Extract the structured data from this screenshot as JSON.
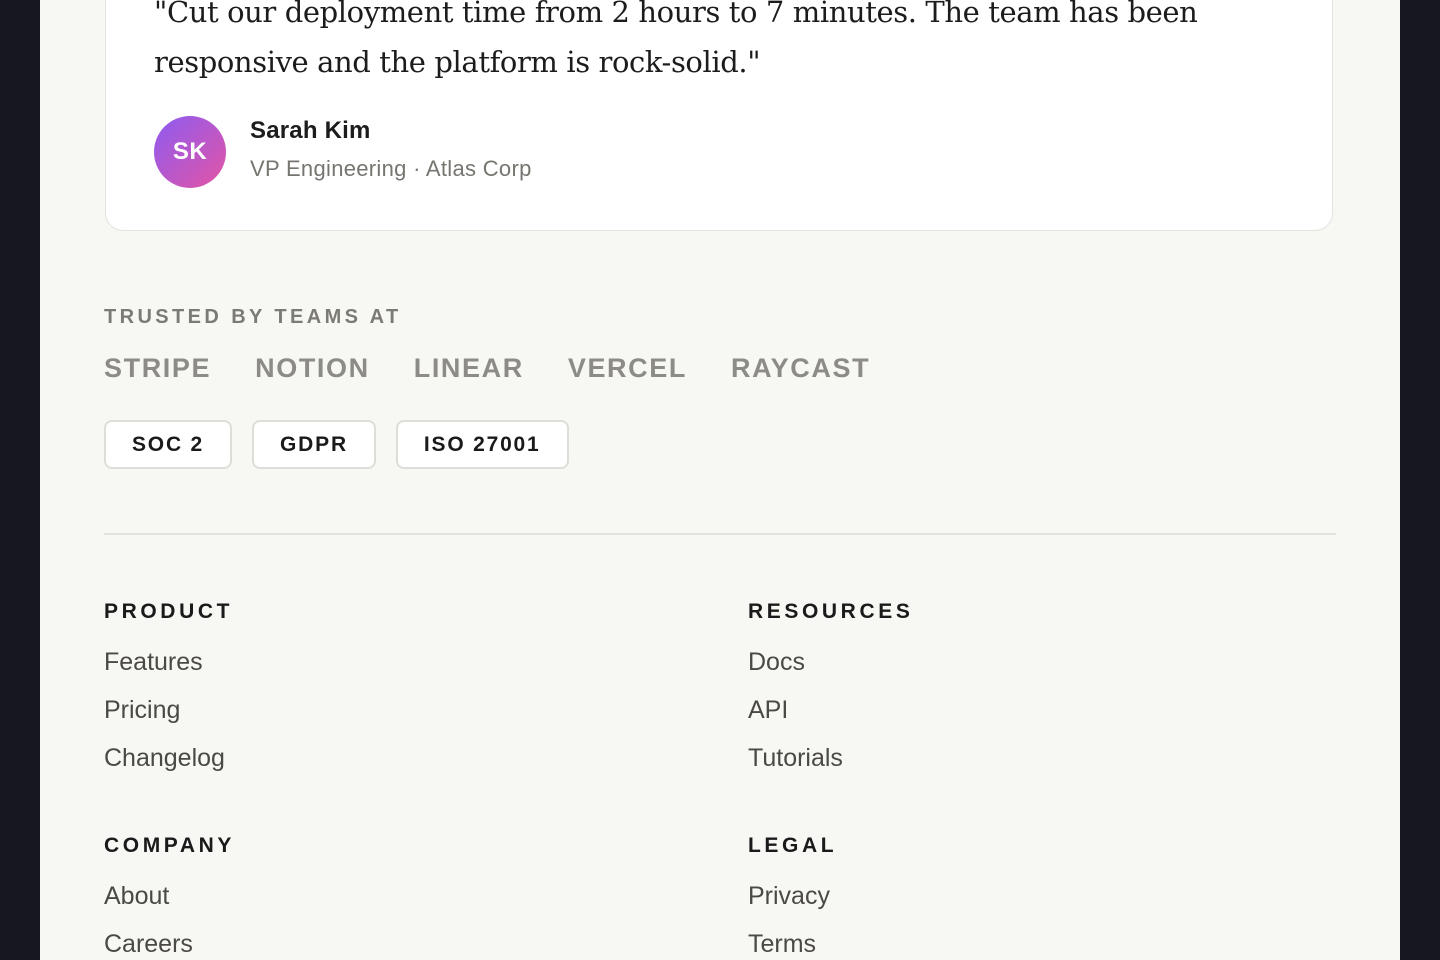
{
  "testimonial": {
    "quote": "\"Cut our deployment time from 2 hours to 7 minutes. The team has been responsive and the platform is rock-solid.\"",
    "avatar_initials": "SK",
    "avatar_gradient": [
      "#8c5cf2",
      "#e454a4"
    ],
    "author_name": "Sarah Kim",
    "author_role": "VP Engineering · Atlas Corp"
  },
  "trusted": {
    "heading": "TRUSTED BY TEAMS AT",
    "logos": [
      "STRIPE",
      "NOTION",
      "LINEAR",
      "VERCEL",
      "RAYCAST"
    ]
  },
  "badges": [
    "SOC 2",
    "GDPR",
    "ISO 27001"
  ],
  "footer": {
    "product": {
      "heading": "PRODUCT",
      "links": [
        "Features",
        "Pricing",
        "Changelog"
      ]
    },
    "resources": {
      "heading": "RESOURCES",
      "links": [
        "Docs",
        "API",
        "Tutorials"
      ]
    },
    "company": {
      "heading": "COMPANY",
      "links": [
        "About",
        "Careers"
      ]
    },
    "legal": {
      "heading": "LEGAL",
      "links": [
        "Privacy",
        "Terms"
      ]
    }
  },
  "colors": {
    "window_background": "#171720",
    "page_background": "#f7f7f4",
    "card_background": "#ffffff",
    "muted_text": "#8d8b86"
  }
}
